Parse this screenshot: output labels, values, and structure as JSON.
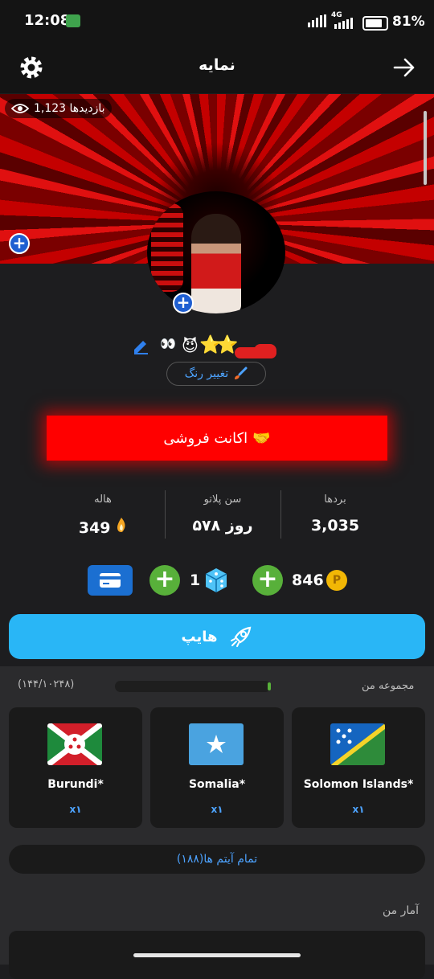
{
  "status": {
    "time": "12:08",
    "network": "4G",
    "battery": "81%"
  },
  "header": {
    "title": "نمایه"
  },
  "banner": {
    "views": "1,123 بازدیدها"
  },
  "profile": {
    "stars": "⭐⭐",
    "change_color_label": "تغییر رنگ",
    "emoji_eyes": "👀",
    "emoji_devil": "😈"
  },
  "sale": {
    "label": "اکانت فروشی",
    "emoji": "🤝"
  },
  "stats": [
    {
      "label": "بردها",
      "value": "3,035"
    },
    {
      "label": "سن پلاتو",
      "value": "۵۷۸ روز"
    },
    {
      "label": "هاله",
      "value": "349"
    }
  ],
  "currency": {
    "coins": "846",
    "coin_symbol": "P",
    "dice": "1"
  },
  "hype": {
    "label": "هایپ"
  },
  "collection": {
    "title": "مجموعه من",
    "count": "(۱۴۴/۱۰۲۴۸)",
    "progress_fraction": 0.98,
    "items": [
      {
        "name": "Solomon Islands*",
        "qty": "x۱"
      },
      {
        "name": "Somalia*",
        "qty": "x۱"
      },
      {
        "name": "Burundi*",
        "qty": "x۱"
      }
    ],
    "all_items_label": "تمام آیتم ها(۱۸۸)"
  },
  "my_stats": {
    "title": "آمار من"
  },
  "colors": {
    "accent": "#29b6f6",
    "sale": "#ff0000",
    "green": "#58b03a",
    "link": "#4da3ff"
  }
}
